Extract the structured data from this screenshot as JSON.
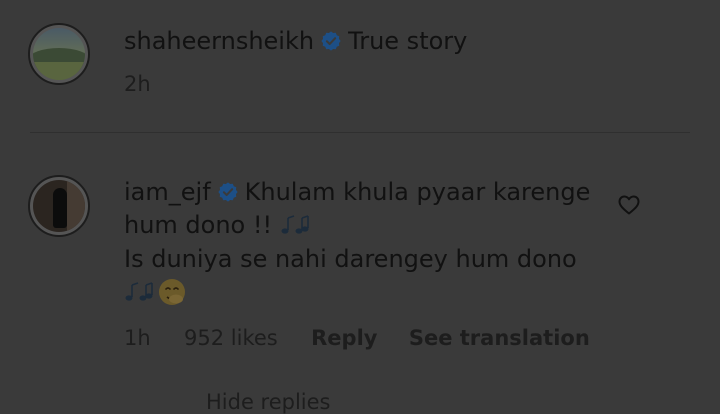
{
  "comment1": {
    "username": "shaheernsheikh",
    "text": "True story",
    "time": "2h",
    "verified_icon": "verified-badge-icon"
  },
  "comment2": {
    "username": "iam_ejf",
    "line1": "Khulam khula pyaar karenge",
    "line2": "hum dono !!",
    "line3": "Is duniya se nahi darengey hum dono",
    "time": "1h",
    "likes": "952 likes",
    "reply_label": "Reply",
    "translation_label": "See translation",
    "verified_icon": "verified-badge-icon",
    "like_icon": "heart-outline-icon"
  },
  "hide_replies_label": "Hide replies",
  "colors": {
    "overlay_background": "#3a3a3a",
    "verified_blue": "#1d4f86"
  }
}
